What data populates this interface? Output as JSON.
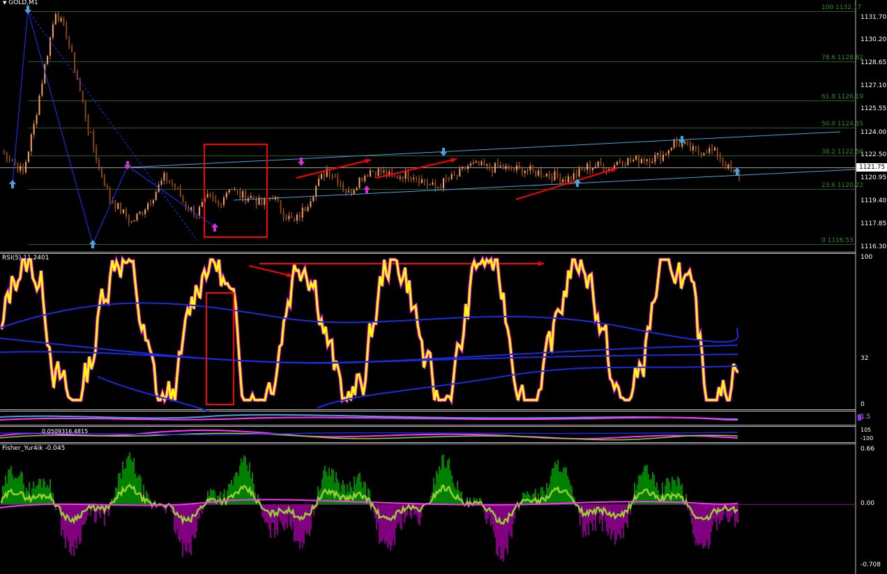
{
  "chart_data": [
    {
      "type": "line",
      "panel": "price",
      "title": "GOLD,M1",
      "yticks": [
        "1131.70",
        "1130.20",
        "1128.65",
        "1127.10",
        "1125.55",
        "1124.00",
        "1122.50",
        "1120.95",
        "1119.40",
        "1117.85",
        "1116.30"
      ],
      "ylim": [
        1116.3,
        1131.7
      ],
      "current_price": "1121.75",
      "fib_levels": [
        {
          "label": "100 1132.17",
          "value": 1132.17
        },
        {
          "label": "78.6 1128.82",
          "value": 1128.82
        },
        {
          "label": "61.8 1126.19",
          "value": 1126.19
        },
        {
          "label": "50.0 1124.35",
          "value": 1124.35
        },
        {
          "label": "38.2 1122.50",
          "value": 1122.5
        },
        {
          "label": "23.6 1120.22",
          "value": 1120.22
        },
        {
          "label": "0 1116.53",
          "value": 1116.53
        }
      ],
      "close": [
        1122.8,
        1122.2,
        1121.3,
        1124.5,
        1128.5,
        1132.2,
        1130.6,
        1127.6,
        1124.3,
        1121.7,
        1119.6,
        1118.8,
        1118.0,
        1118.8,
        1119.8,
        1121.0,
        1120.4,
        1119.1,
        1118.6,
        1119.6,
        1119.2,
        1120.4,
        1119.8,
        1119.7,
        1119.2,
        1119.8,
        1118.6,
        1118.0,
        1119.0,
        1120.4,
        1121.6,
        1120.9,
        1119.9,
        1120.9,
        1121.5,
        1121.4,
        1121.0,
        1121.2,
        1121.2,
        1120.7,
        1120.3,
        1120.8,
        1121.1,
        1121.8,
        1121.8,
        1121.6,
        1121.7,
        1121.5,
        1121.6,
        1121.4,
        1121.3,
        1121.1,
        1120.9,
        1121.2,
        1121.7,
        1121.8,
        1121.6,
        1122.2,
        1122.1,
        1122.3,
        1122.3,
        1122.5,
        1123.4,
        1123.1,
        1122.7,
        1122.9,
        1122.6,
        1121.6,
        1121.0
      ],
      "series": [
        {
          "name": "RSI(5) 11.2401",
          "panel": "rsi",
          "yticks": [
            "100",
            "32",
            "0"
          ],
          "ylim": [
            0,
            100
          ]
        },
        {
          "name": "Fisher_Yur4ik -0.045",
          "panel": "fisher",
          "yticks": [
            "0.66",
            "0.00",
            "-0.708"
          ],
          "ylim": [
            -0.708,
            0.66
          ]
        }
      ],
      "sub_panel_labels": {
        "mid1_right": "1.5",
        "mid2_text": "0.0509316.4815",
        "mid2_right_top": "105",
        "mid2_right_bottom": "-100"
      }
    }
  ],
  "colors": {
    "background": "#000000",
    "grid": "#1f5f1f",
    "candles": "#d2691e",
    "rsi": "#ffff00",
    "rsi_glow": "#ff00ff",
    "fisher_pos": "#008000",
    "fisher_neg": "#800080",
    "fisher_line": "#9acd32",
    "channel": "#4aa3df",
    "annotation": "#ff0000"
  }
}
